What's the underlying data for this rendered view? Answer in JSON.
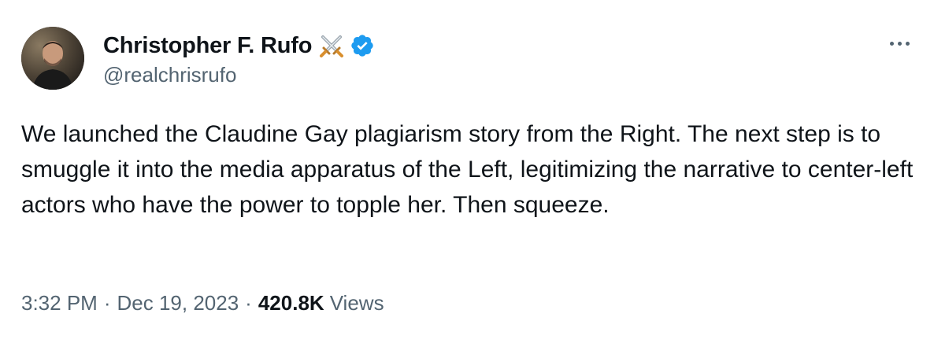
{
  "author": {
    "display_name": "Christopher F. Rufo",
    "handle": "@realchrisrufo",
    "badge_emoji_icon": "crossed-swords-icon",
    "verified_icon": "verified-badge-icon",
    "verified_color": "#1d9bf0"
  },
  "tweet": {
    "text": "We launched the Claudine Gay plagiarism story from the Right. The next step is to smuggle it into the media apparatus of the Left, legitimizing the narrative to center-left actors who have the power to topple her. Then squeeze."
  },
  "meta": {
    "time": "3:32 PM",
    "separator": "·",
    "date": "Dec 19, 2023",
    "views_count": "420.8K",
    "views_label": "Views"
  },
  "more_icon": "more-horizontal-icon",
  "colors": {
    "text_primary": "#0f1419",
    "text_secondary": "#536471",
    "background": "#ffffff"
  }
}
